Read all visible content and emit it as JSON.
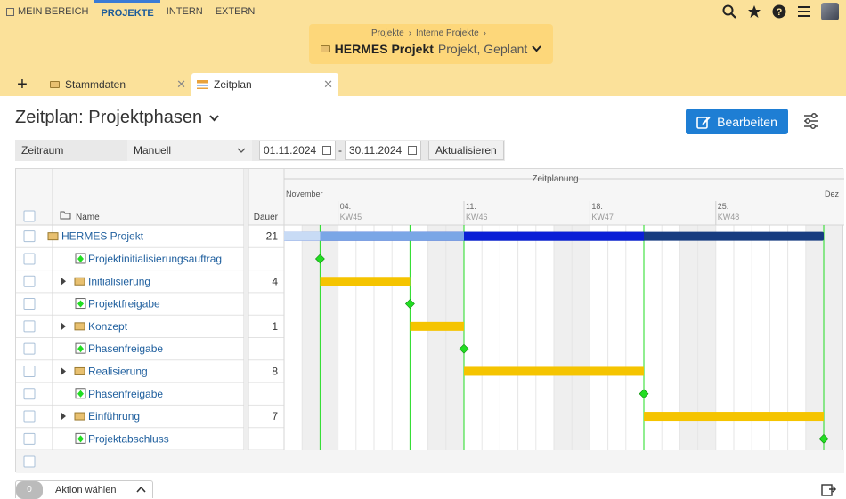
{
  "nav": {
    "items": [
      {
        "label": "MEIN BEREICH",
        "active": false,
        "icon": "home-icon"
      },
      {
        "label": "PROJEKTE",
        "active": true
      },
      {
        "label": "INTERN",
        "active": false
      },
      {
        "label": "EXTERN",
        "active": false
      }
    ],
    "icons": [
      "search-icon",
      "star-icon",
      "help-icon",
      "menu-icon",
      "avatar"
    ]
  },
  "project": {
    "breadcrumb": [
      "Projekte",
      "Interne Projekte"
    ],
    "name": "HERMES Projekt",
    "subtitle": "Projekt, Geplant"
  },
  "tabs": [
    {
      "label": "Stammdaten",
      "icon": "folder-icon"
    },
    {
      "label": "Zeitplan",
      "icon": "timeline-icon",
      "active": true
    }
  ],
  "page": {
    "title": "Zeitplan: Projektphasen",
    "edit_label": "Bearbeiten"
  },
  "filter": {
    "label": "Zeitraum",
    "mode": "Manuell",
    "from": "01.11.2024",
    "dash": "-",
    "to": "30.11.2024",
    "refresh": "Aktualisieren"
  },
  "table": {
    "col_name": "Name",
    "col_duration": "Dauer",
    "timeline_header": "Zeitplanung",
    "months": [
      "November",
      "Dez"
    ],
    "weeks": [
      {
        "day": "04.",
        "kw": "KW45",
        "col": 3
      },
      {
        "day": "11.",
        "kw": "KW46",
        "col": 10
      },
      {
        "day": "18.",
        "kw": "KW47",
        "col": 17
      },
      {
        "day": "25.",
        "kw": "KW48",
        "col": 24
      }
    ],
    "rows": [
      {
        "name": "HERMES Projekt",
        "type": "project",
        "indent": 0,
        "expander": false,
        "duration": "21",
        "start": 0,
        "end": 30,
        "progress_end": 10,
        "mid_end": 20
      },
      {
        "name": "Projektinitialisierungsauftrag",
        "type": "milestone",
        "indent": 1,
        "expander": false,
        "duration": "",
        "at": 2
      },
      {
        "name": "Initialisierung",
        "type": "phase",
        "indent": 1,
        "expander": true,
        "duration": "4",
        "start": 2,
        "end": 7
      },
      {
        "name": "Projektfreigabe",
        "type": "milestone",
        "indent": 1,
        "expander": false,
        "duration": "",
        "at": 7
      },
      {
        "name": "Konzept",
        "type": "phase",
        "indent": 1,
        "expander": true,
        "duration": "1",
        "start": 7,
        "end": 10
      },
      {
        "name": "Phasenfreigabe",
        "type": "milestone",
        "indent": 1,
        "expander": false,
        "duration": "",
        "at": 10
      },
      {
        "name": "Realisierung",
        "type": "phase",
        "indent": 1,
        "expander": true,
        "duration": "8",
        "start": 10,
        "end": 20
      },
      {
        "name": "Phasenfreigabe",
        "type": "milestone",
        "indent": 1,
        "expander": false,
        "duration": "",
        "at": 20
      },
      {
        "name": "Einführung",
        "type": "phase",
        "indent": 1,
        "expander": true,
        "duration": "7",
        "start": 20,
        "end": 30
      },
      {
        "name": "Projektabschluss",
        "type": "milestone",
        "indent": 1,
        "expander": false,
        "duration": "",
        "at": 30
      }
    ]
  },
  "footer": {
    "count": "0",
    "action": "Aktion wählen"
  },
  "colors": {
    "accent": "#1e7ed4",
    "header_bg": "#fbe19a",
    "phase_bar": "#f5c400",
    "milestone": "#22dd22",
    "project_bar_light": "#7aa6e6",
    "project_bar_mid": "#0a1fd6",
    "project_bar_dark": "#173c80"
  }
}
